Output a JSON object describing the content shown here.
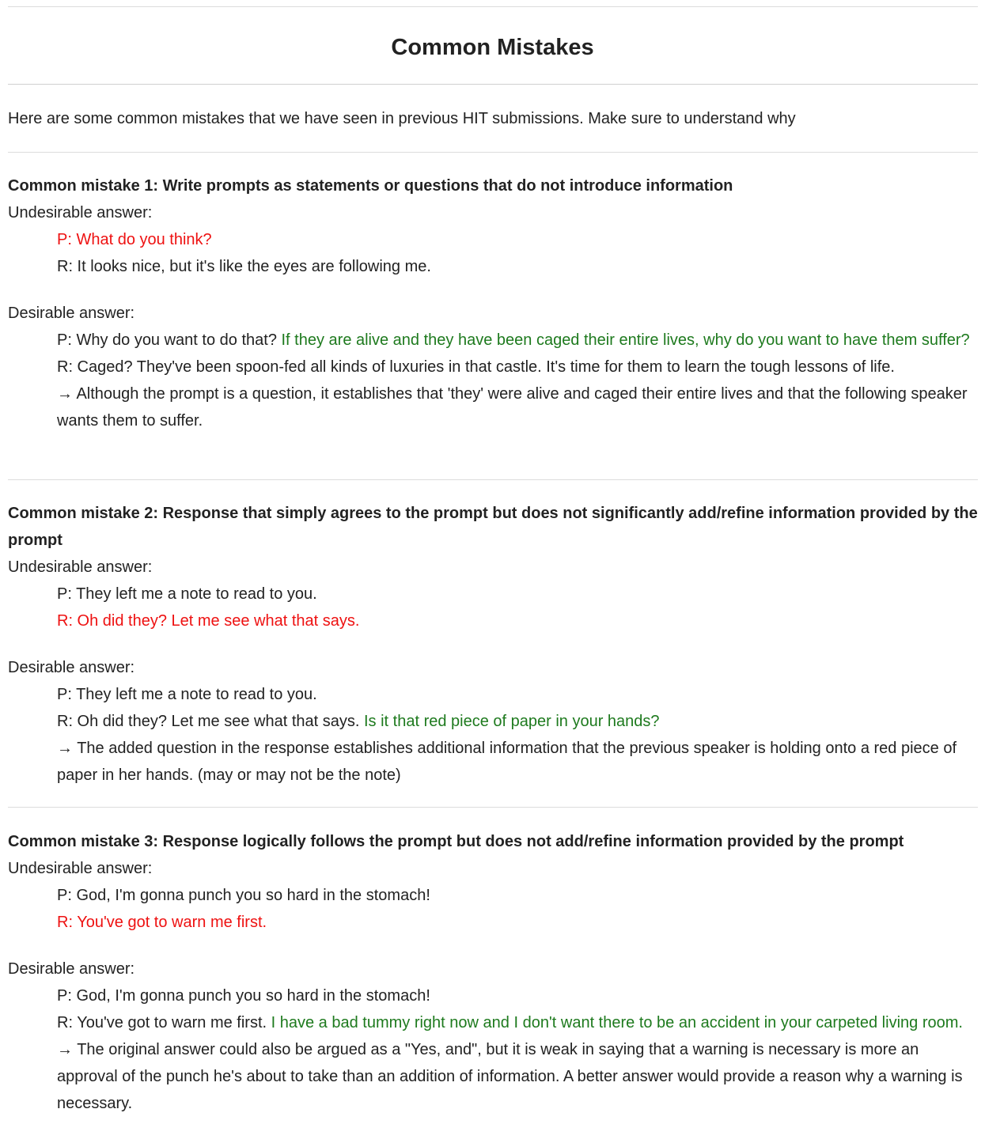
{
  "title": "Common Mistakes",
  "intro": "Here are some common mistakes that we have seen in previous HIT submissions. Make sure to understand why",
  "labels": {
    "undesirable": "Undesirable answer:",
    "desirable": "Desirable answer:"
  },
  "colors": {
    "bad": "#ee1111",
    "good": "#1e7a1e",
    "text": "#222222"
  },
  "mistakes": [
    {
      "heading": "Common mistake 1: Write prompts as statements or questions that do not introduce information",
      "undesirable": {
        "p": "P: What do you think?",
        "r": "R: It looks nice, but it's like the eyes are following me."
      },
      "desirable": {
        "p": "P: Why do you want to do that? ",
        "p_added": "If they are alive and they have been caged their entire lives, why do you want to have them suffer?",
        "r": "R: Caged? They've been spoon-fed all kinds of luxuries in that castle. It's time for them to learn the tough lessons of life.",
        "note": "→ Although the prompt is a question, it establishes that 'they' were alive and caged their entire lives and that the following speaker wants them to suffer."
      }
    },
    {
      "heading": "Common mistake 2: Response that simply agrees to the prompt but does not significantly add/refine information provided by the prompt",
      "undesirable": {
        "p": "P: They left me a note to read to you.",
        "r": "R: Oh did they? Let me see what that says."
      },
      "desirable": {
        "p": "P: They left me a note to read to you.",
        "r": "R: Oh did they? Let me see what that says. ",
        "r_added": "Is it that red piece of paper in your hands?",
        "note": "→ The added question in the response establishes additional information that the previous speaker is holding onto a red piece of paper in her hands. (may or may not be the note)"
      }
    },
    {
      "heading": "Common mistake 3: Response logically follows the prompt but does not add/refine information provided by the prompt",
      "undesirable": {
        "p": "P: God, I'm gonna punch you so hard in the stomach!",
        "r": "R: You've got to warn me first."
      },
      "desirable": {
        "p": "P: God, I'm gonna punch you so hard in the stomach!",
        "r": "R: You've got to warn me first. ",
        "r_added": "I have a bad tummy right now and I don't want there to be an accident in your carpeted living room.",
        "note": "→ The original answer could also be argued as a \"Yes, and\", but it is weak in saying that a warning is necessary is more an approval of the punch he's about to take than an addition of information. A better answer would provide a reason why a warning is necessary."
      }
    }
  ]
}
